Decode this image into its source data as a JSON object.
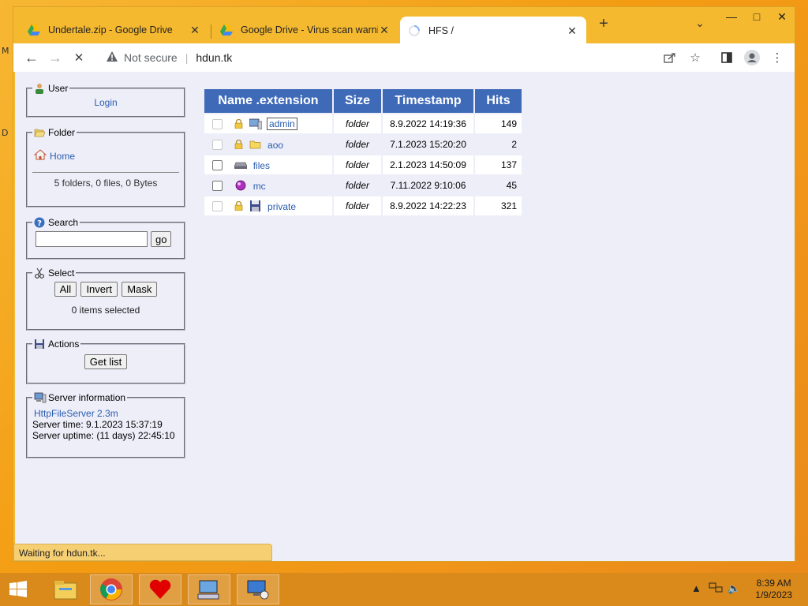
{
  "desktop": {
    "edge_labels": [
      "M",
      "D"
    ]
  },
  "window": {
    "minimize": "—",
    "maximize": "□",
    "close": "✕"
  },
  "tabs": [
    {
      "title": "Undertale.zip - Google Drive",
      "favicon": "google-drive-icon",
      "close": "✕"
    },
    {
      "title": "Google Drive - Virus scan warnin",
      "favicon": "google-drive-icon",
      "close": "✕"
    },
    {
      "title": "HFS /",
      "favicon": "loading-spinner-icon",
      "close": "✕"
    }
  ],
  "tabstrip": {
    "new_tab": "+",
    "tab_search": "⌄"
  },
  "toolbar": {
    "back": "←",
    "forward": "→",
    "stop": "✕",
    "security_label": "Not secure",
    "url": "hdun.tk",
    "share_icon": "share-icon",
    "bookmark_icon": "star-icon",
    "side_panel_icon": "side-panel-icon",
    "profile_icon": "profile-icon",
    "menu_icon": "menu-icon"
  },
  "panels": {
    "user": {
      "legend": "User",
      "login": "Login"
    },
    "folder": {
      "legend": "Folder",
      "home": "Home",
      "summary": "5 folders, 0 files, 0 Bytes"
    },
    "search": {
      "legend": "Search",
      "value": "",
      "go": "go"
    },
    "select": {
      "legend": "Select",
      "all": "All",
      "invert": "Invert",
      "mask": "Mask",
      "status": "0 items selected"
    },
    "actions": {
      "legend": "Actions",
      "get_list": "Get list"
    },
    "server": {
      "legend": "Server information",
      "software": "HttpFileServer 2.3m",
      "time": "Server time: 9.1.2023 15:37:19",
      "uptime": "Server uptime: (11 days) 22:45:10"
    }
  },
  "files": {
    "headers": {
      "name": "Name .extension",
      "size": "Size",
      "timestamp": "Timestamp",
      "hits": "Hits"
    },
    "rows": [
      {
        "name": "admin",
        "locked": true,
        "icon": "computer-folder-icon",
        "size": "folder",
        "timestamp": "8.9.2022 14:19:36",
        "hits": "149"
      },
      {
        "name": "aoo",
        "locked": true,
        "icon": "folder-icon",
        "size": "folder",
        "timestamp": "7.1.2023 15:20:20",
        "hits": "2"
      },
      {
        "name": "files",
        "locked": false,
        "icon": "drive-icon",
        "size": "folder",
        "timestamp": "2.1.2023 14:50:09",
        "hits": "137"
      },
      {
        "name": "mc",
        "locked": false,
        "icon": "orb-icon",
        "size": "folder",
        "timestamp": "7.11.2022 9:10:06",
        "hits": "45"
      },
      {
        "name": "private",
        "locked": true,
        "icon": "floppy-icon",
        "size": "folder",
        "timestamp": "8.9.2022 14:22:23",
        "hits": "321"
      }
    ]
  },
  "status_bar": "Waiting for hdun.tk...",
  "taskbar": {
    "apps": [
      "windows-start-icon",
      "file-explorer-icon",
      "chrome-icon",
      "undertale-heart-icon",
      "network-computer-icon",
      "remote-desktop-icon"
    ],
    "clock_time": "8:39 AM",
    "clock_date": "1/9/2023"
  },
  "colors": {
    "header_blue": "#3f6ab8",
    "link_blue": "#2a5db0",
    "page_bg": "#eeeef9",
    "taskbar_orange": "#d98a1a"
  }
}
